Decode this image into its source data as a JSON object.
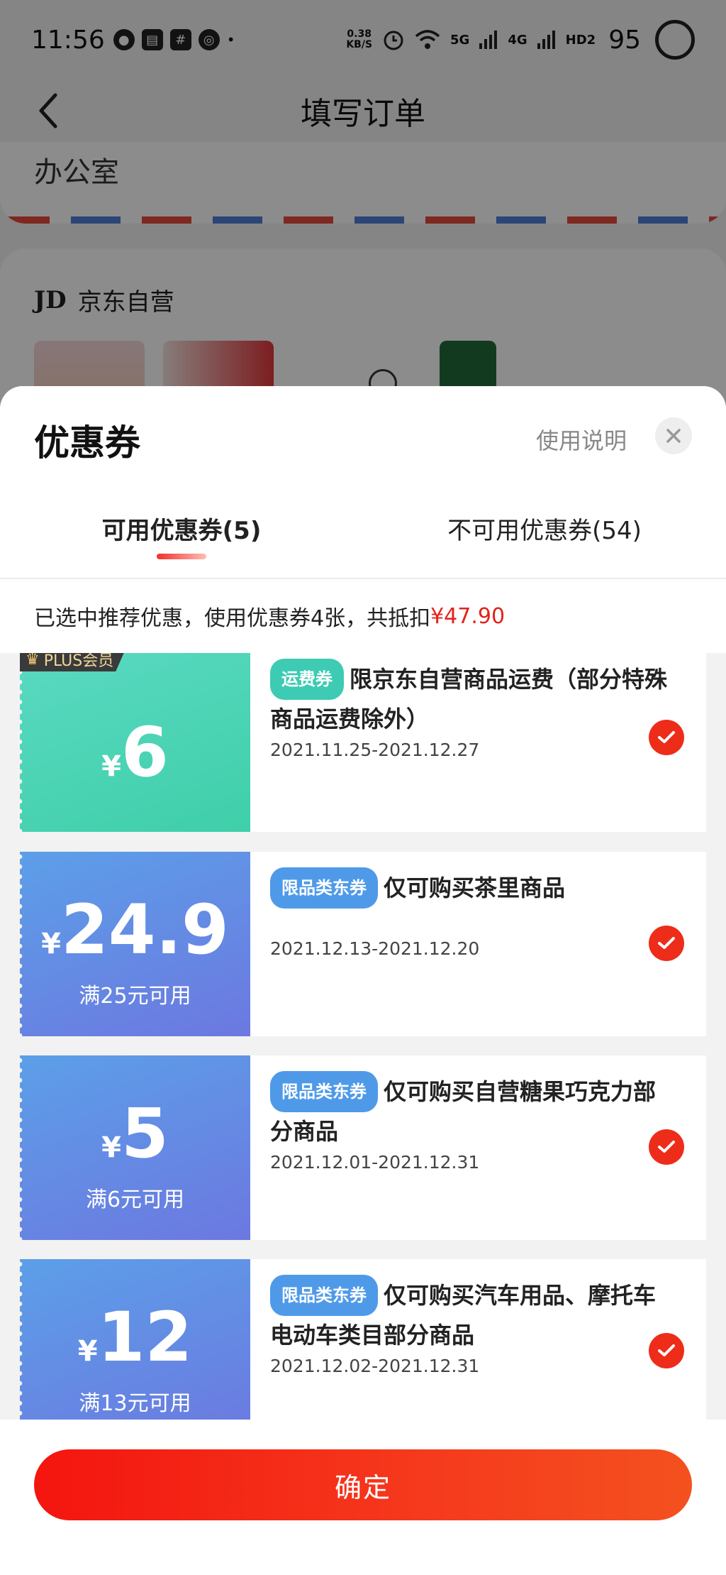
{
  "status_bar": {
    "time": "11:56",
    "net_speed_top": "0.38",
    "net_speed_bottom": "KB/S",
    "signal_5g": "5G",
    "signal_4g": "4G",
    "hd": "HD2",
    "battery": "95"
  },
  "nav": {
    "title": "填写订单"
  },
  "address": {
    "text": "办公室"
  },
  "shop": {
    "logo": "JD",
    "name": "京东自营"
  },
  "sheet": {
    "title": "优惠券",
    "help_link": "使用说明",
    "tabs": [
      {
        "label": "可用优惠券(5)"
      },
      {
        "label": "不可用优惠券(54)"
      }
    ],
    "summary_prefix": "已选中推荐优惠，使用优惠券4张，共抵扣",
    "summary_amount": "¥47.90"
  },
  "coupons": [
    {
      "badge": "PLUS会员",
      "currency": "¥",
      "amount": "6",
      "condition": "",
      "tag": "运费券",
      "title": "限京东自营商品运费（部分特殊商品运费除外）",
      "date": "2021.11.25-2021.12.27",
      "checked": true
    },
    {
      "currency": "¥",
      "amount": "24.9",
      "condition": "满25元可用",
      "tag": "限品类东券",
      "title": "仅可购买茶里商品",
      "date": "2021.12.13-2021.12.20",
      "checked": true
    },
    {
      "currency": "¥",
      "amount": "5",
      "condition": "满6元可用",
      "tag": "限品类东券",
      "title": "仅可购买自营糖果巧克力部分商品",
      "date": "2021.12.01-2021.12.31",
      "checked": true
    },
    {
      "currency": "¥",
      "amount": "12",
      "condition": "满13元可用",
      "tag": "限品类东券",
      "title": "仅可购买汽车用品、摩托车电动车类目部分商品",
      "date": "2021.12.02-2021.12.31",
      "checked": true
    }
  ],
  "footer": {
    "confirm_label": "确定"
  },
  "colors": {
    "accent": "#e2231a",
    "teal": "#3ecbb3",
    "blue": "#4f9ae8"
  },
  "icons": [
    "back-arrow-icon",
    "close-icon",
    "check-icon",
    "crown-icon"
  ]
}
